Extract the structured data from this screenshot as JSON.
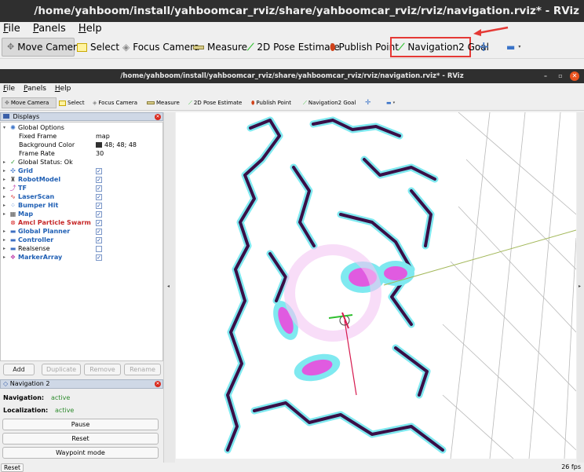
{
  "window_title": "/home/yahboom/install/yahboomcar_rviz/share/yahboomcar_rviz/rviz/navigation.rviz* - RViz",
  "menu": [
    "File",
    "Panels",
    "Help"
  ],
  "toolbar": {
    "move_camera": "Move Camera",
    "select": "Select",
    "focus_camera": "Focus Camera",
    "measure": "Measure",
    "pose_estimate": "2D Pose Estimate",
    "publish_point": "Publish Point",
    "nav_goal": "Navigation2 Goal"
  },
  "colors": {
    "highlight": "#e53935",
    "titlebar": "#2f2f2f",
    "close": "#e95420",
    "costmap": "#7fe9f0",
    "obstacle": "#3a0f47",
    "inflation": "#e05be0"
  },
  "inner_window_title": "/home/yahboom/install/yahboomcar_rviz/share/yahboomcar_rviz/rviz/navigation.rviz* - RViz",
  "displays": {
    "header": "Displays",
    "global_options": "Global Options",
    "fixed_frame_label": "Fixed Frame",
    "fixed_frame_value": "map",
    "bg_color_label": "Background Color",
    "bg_color_value": "48; 48; 48",
    "frame_rate_label": "Frame Rate",
    "frame_rate_value": "30",
    "global_status": "Global Status: Ok",
    "items": [
      {
        "name": "Grid",
        "checked": true
      },
      {
        "name": "RobotModel",
        "checked": true
      },
      {
        "name": "TF",
        "checked": true
      },
      {
        "name": "LaserScan",
        "checked": true
      },
      {
        "name": "Bumper Hit",
        "checked": true
      },
      {
        "name": "Map",
        "checked": true
      },
      {
        "name": "Amcl Particle Swarm",
        "checked": true
      },
      {
        "name": "Global Planner",
        "checked": true
      },
      {
        "name": "Controller",
        "checked": true
      },
      {
        "name": "Realsense",
        "checked": false
      },
      {
        "name": "MarkerArray",
        "checked": true
      }
    ],
    "buttons": {
      "add": "Add",
      "duplicate": "Duplicate",
      "remove": "Remove",
      "rename": "Rename"
    }
  },
  "nav2": {
    "header": "Navigation 2",
    "navigation_label": "Navigation:",
    "navigation_value": "active",
    "localization_label": "Localization:",
    "localization_value": "active",
    "pause": "Pause",
    "reset": "Reset",
    "waypoint": "Waypoint mode"
  },
  "status": {
    "reset": "Reset",
    "fps": "26 fps"
  }
}
